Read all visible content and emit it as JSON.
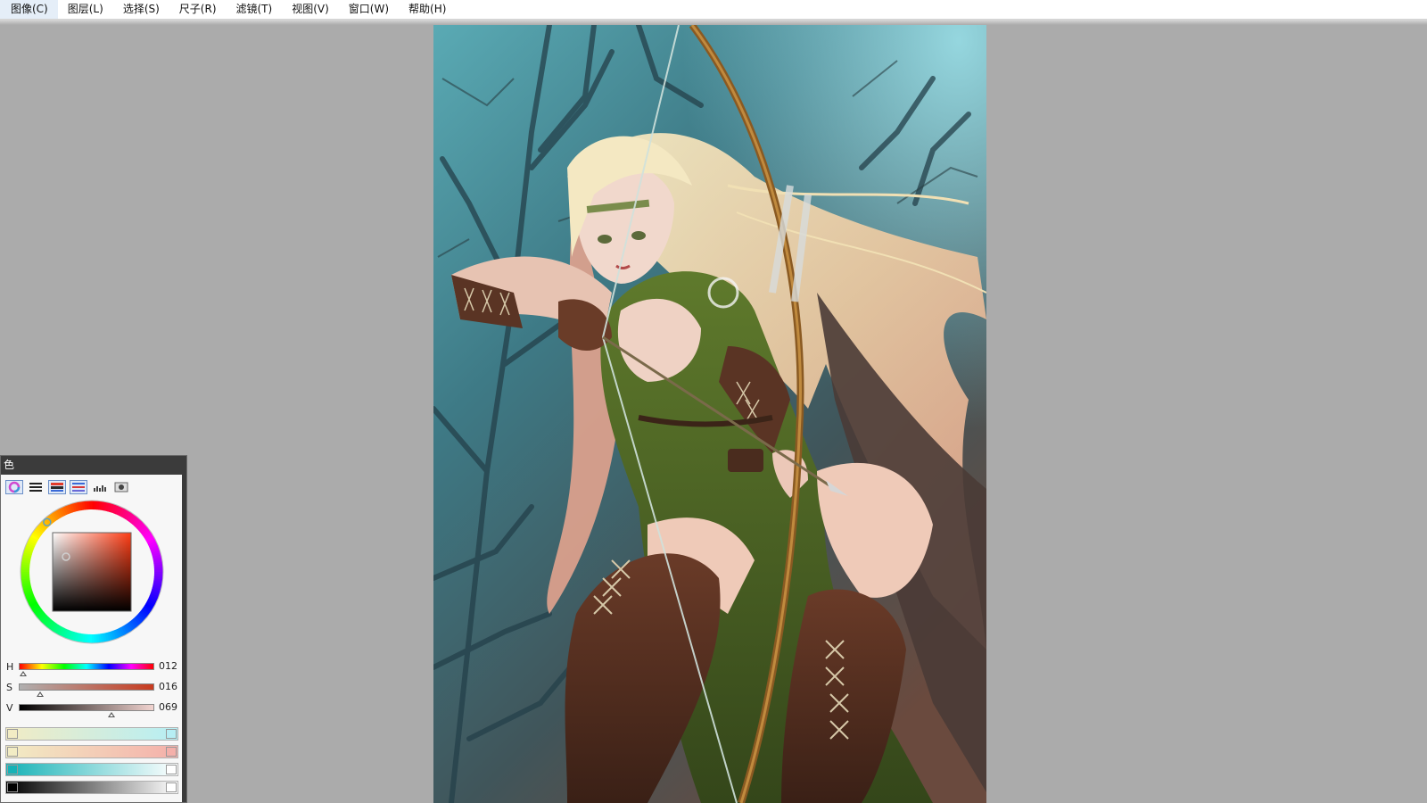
{
  "menu": {
    "items": [
      "图像(C)",
      "图层(L)",
      "选择(S)",
      "尺子(R)",
      "滤镜(T)",
      "视图(V)",
      "窗口(W)",
      "帮助(H)"
    ]
  },
  "canvas": {
    "description_icon": "artwork-canvas"
  },
  "color_panel": {
    "title": "色",
    "tabs": [
      "color-wheel-icon",
      "rgb-sliders-icon",
      "hsv-sliders-icon",
      "palette-icon",
      "swatches-icon",
      "mix-icon"
    ],
    "active_tab": 0,
    "hue_deg": 12,
    "wheel_marker_color": "#5aa0c8",
    "sliders": [
      {
        "label": "H",
        "value": "012",
        "level": 0.033
      },
      {
        "label": "S",
        "value": "016",
        "level": 0.16
      },
      {
        "label": "V",
        "value": "069",
        "level": 0.69
      }
    ],
    "gradients": [
      {
        "left": "#f2ecc4",
        "right": "#b6eef4"
      },
      {
        "left": "#f2ecc4",
        "right": "#f4b0aa"
      },
      {
        "left": "#16b2b6",
        "right": "#ffffff"
      },
      {
        "left": "#000000",
        "right": "#ffffff"
      }
    ],
    "colors": {
      "panel_bg": "#f7f7f7",
      "title_bg": "#3b3b3b",
      "current_hue": "#ff3c14"
    }
  }
}
